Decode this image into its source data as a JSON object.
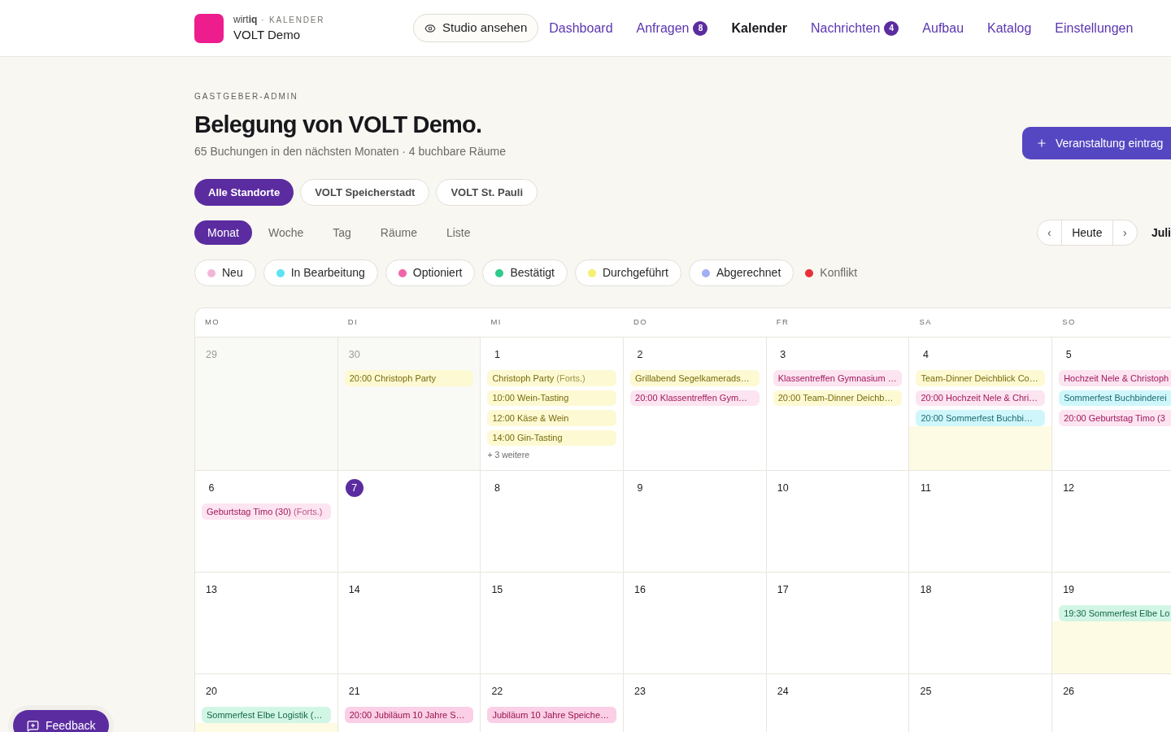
{
  "header": {
    "brand": "wirt**iq**",
    "section": "· KALENDER",
    "venue": "VOLT Demo",
    "studio_button": "Studio ansehen",
    "nav": [
      {
        "label": "Dashboard",
        "selected": false
      },
      {
        "label": "Anfragen",
        "badge": "8",
        "selected": false
      },
      {
        "label": "Kalender",
        "selected": true
      },
      {
        "label": "Nachrichten",
        "badge": "4",
        "selected": false
      },
      {
        "label": "Aufbau",
        "selected": false
      },
      {
        "label": "Katalog",
        "selected": false
      },
      {
        "label": "Einstellungen",
        "selected": false
      }
    ]
  },
  "page": {
    "kicker": "GASTGEBER-ADMIN",
    "title": "Belegung von VOLT Demo.",
    "subtitle": "65 Buchungen in den nächsten Monaten · 4 buchbare Räume",
    "add_button": "Veranstaltung eintrag"
  },
  "locations": [
    {
      "label": "Alle Standorte",
      "selected": true
    },
    {
      "label": "VOLT Speicherstadt",
      "selected": false
    },
    {
      "label": "VOLT St. Pauli",
      "selected": false
    }
  ],
  "views": [
    {
      "label": "Monat",
      "selected": true
    },
    {
      "label": "Woche",
      "selected": false
    },
    {
      "label": "Tag",
      "selected": false
    },
    {
      "label": "Räume",
      "selected": false
    },
    {
      "label": "Liste",
      "selected": false
    }
  ],
  "date_navigation": {
    "previous": "‹",
    "today": "Heute",
    "next": "›",
    "month": "Juli"
  },
  "legend": [
    {
      "label": "Neu",
      "color": "#f2b6d6",
      "kind": "chip"
    },
    {
      "label": "In Bearbeitung",
      "color": "#5de3f3",
      "kind": "chip"
    },
    {
      "label": "Optioniert",
      "color": "#f066a9",
      "kind": "chip"
    },
    {
      "label": "Bestätigt",
      "color": "#2fc98b",
      "kind": "chip"
    },
    {
      "label": "Durchgeführt",
      "color": "#f6ef72",
      "kind": "chip"
    },
    {
      "label": "Abgerechnet",
      "color": "#a3aef5",
      "kind": "chip"
    },
    {
      "label": "Konflikt",
      "color": "#e8303a",
      "kind": "plain"
    }
  ],
  "calendar": {
    "weekdays": [
      "MO",
      "DI",
      "MI",
      "DO",
      "FR",
      "SA",
      "SO"
    ],
    "weeks": [
      {
        "days": [
          {
            "day": "29",
            "outside_month": true,
            "today": false,
            "highlight": false
          },
          {
            "day": "30",
            "outside_month": true,
            "today": false,
            "highlight": false,
            "events": [
              {
                "title": "20:00 Christoph Party",
                "color": "#fdf9d3"
              }
            ]
          },
          {
            "day": "1",
            "outside_month": false,
            "today": false,
            "highlight": false,
            "events": [
              {
                "title": "Christoph Party",
                "note": "(Forts.)",
                "color": "#fdf9d3"
              },
              {
                "title": "10:00 Wein-Tasting",
                "color": "#fdf9d3"
              },
              {
                "title": "12:00 Käse & Wein",
                "color": "#fdf9d3"
              },
              {
                "title": "14:00 Gin-Tasting",
                "color": "#fdf9d3"
              }
            ],
            "more": "+ 3 weitere"
          },
          {
            "day": "2",
            "outside_month": false,
            "today": false,
            "highlight": false,
            "events": [
              {
                "title": "Grillabend Segelkamerads…",
                "color": "#fdf9d3"
              },
              {
                "title": "20:00 Klassentreffen Gym…",
                "color": "#fce4f1"
              }
            ]
          },
          {
            "day": "3",
            "outside_month": false,
            "today": false,
            "highlight": false,
            "events": [
              {
                "title": "Klassentreffen Gymnasium …",
                "color": "#fce4f1"
              },
              {
                "title": "20:00 Team-Dinner Deichb…",
                "color": "#fdf9d3"
              }
            ]
          },
          {
            "day": "4",
            "outside_month": false,
            "today": false,
            "highlight": true,
            "events": [
              {
                "title": "Team-Dinner Deichblick Co…",
                "color": "#fdf9d3"
              },
              {
                "title": "20:00 Hochzeit Nele & Chri…",
                "color": "#fce4f1"
              },
              {
                "title": "20:00 Sommerfest Buchbi…",
                "color": "#cff7fb"
              }
            ]
          },
          {
            "day": "5",
            "outside_month": false,
            "today": false,
            "highlight": false,
            "events": [
              {
                "title": "Hochzeit Nele & Christoph",
                "color": "#fce4f1"
              },
              {
                "title": "Sommerfest Buchbinderei",
                "color": "#cff7fb"
              },
              {
                "title": "20:00 Geburtstag Timo (3",
                "color": "#fce4f1"
              }
            ]
          }
        ]
      },
      {
        "days": [
          {
            "day": "6",
            "outside_month": false,
            "today": false,
            "highlight": false,
            "events": [
              {
                "title": "Geburtstag Timo (30)",
                "note": "(Forts.)",
                "color": "#fce4f1"
              }
            ]
          },
          {
            "day": "7",
            "outside_month": false,
            "today": true,
            "highlight": false
          },
          {
            "day": "8",
            "outside_month": false,
            "today": false,
            "highlight": false
          },
          {
            "day": "9",
            "outside_month": false,
            "today": false,
            "highlight": false
          },
          {
            "day": "10",
            "outside_month": false,
            "today": false,
            "highlight": false
          },
          {
            "day": "11",
            "outside_month": false,
            "today": false,
            "highlight": false
          },
          {
            "day": "12",
            "outside_month": false,
            "today": false,
            "highlight": false
          }
        ]
      },
      {
        "days": [
          {
            "day": "13",
            "outside_month": false,
            "today": false,
            "highlight": false
          },
          {
            "day": "14",
            "outside_month": false,
            "today": false,
            "highlight": false
          },
          {
            "day": "15",
            "outside_month": false,
            "today": false,
            "highlight": false
          },
          {
            "day": "16",
            "outside_month": false,
            "today": false,
            "highlight": false
          },
          {
            "day": "17",
            "outside_month": false,
            "today": false,
            "highlight": false
          },
          {
            "day": "18",
            "outside_month": false,
            "today": false,
            "highlight": false
          },
          {
            "day": "19",
            "outside_month": false,
            "today": false,
            "highlight": true,
            "events": [
              {
                "title": "19:30 Sommerfest Elbe Lo",
                "color": "#d2f6e5"
              }
            ]
          }
        ]
      },
      {
        "days": [
          {
            "day": "20",
            "outside_month": false,
            "today": false,
            "highlight": true,
            "events": [
              {
                "title": "Sommerfest Elbe Logistik (…",
                "color": "#d2f6e5"
              }
            ]
          },
          {
            "day": "21",
            "outside_month": false,
            "today": false,
            "highlight": false,
            "events": [
              {
                "title": "20:00 Jubiläum 10 Jahre S…",
                "color": "#fbcfe6"
              }
            ]
          },
          {
            "day": "22",
            "outside_month": false,
            "today": false,
            "highlight": false,
            "events": [
              {
                "title": "Jubiläum 10 Jahre Speiche…",
                "color": "#fbcfe6"
              }
            ]
          },
          {
            "day": "23",
            "outside_month": false,
            "today": false,
            "highlight": false
          },
          {
            "day": "24",
            "outside_month": false,
            "today": false,
            "highlight": false
          },
          {
            "day": "25",
            "outside_month": false,
            "today": false,
            "highlight": false
          },
          {
            "day": "26",
            "outside_month": false,
            "today": false,
            "highlight": false
          }
        ]
      }
    ]
  },
  "feedback_button": "Feedback"
}
